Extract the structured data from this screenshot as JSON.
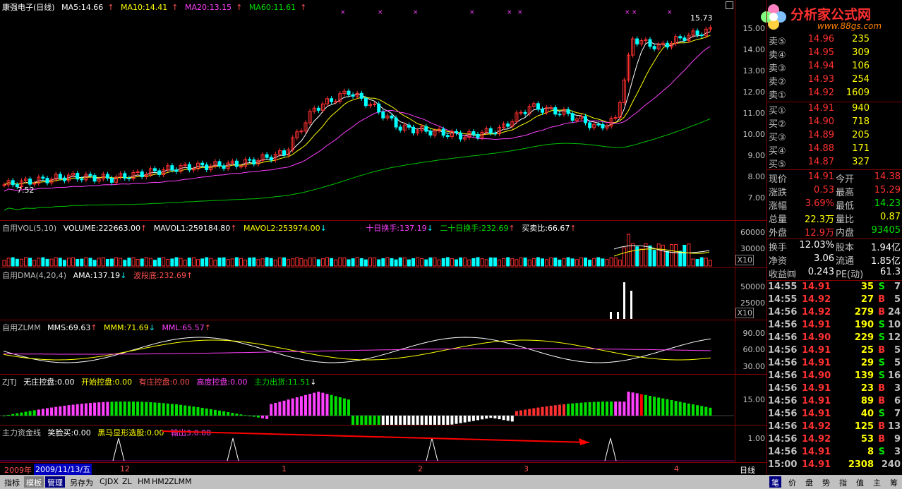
{
  "main": {
    "title": "康强电子(日线)",
    "ma5": "MA5:14.66",
    "ma10": "MA10:14.41",
    "ma20": "MA20:13.15",
    "ma60": "MA60:11.61",
    "high_label": "15.73",
    "low_label": "7.52",
    "yticks": [
      "15.00",
      "14.00",
      "13.00",
      "12.00",
      "11.00",
      "10.00",
      "9.00",
      "8.00",
      "7.00"
    ]
  },
  "vol": {
    "name": "自用VOL(5,10)",
    "volume": "VOLUME:222663.00",
    "mavol1": "MAVOL1:259184.80",
    "mavol2": "MAVOL2:253974.00",
    "turn10": "十日换手:137.19",
    "turn20": "二十日换手:232.69",
    "ratio": "买卖比:66.67",
    "yticks": [
      "60000",
      "30000"
    ],
    "unit": "X10"
  },
  "dma": {
    "name": "自用DMA(4,20,4)",
    "ama": "AMA:137.19",
    "wave": "波段底:232.69",
    "yticks": [
      "50000",
      "25000"
    ],
    "unit": "X10"
  },
  "zlmm": {
    "name": "自用ZLMM",
    "mms": "MMS:69.63",
    "mmm": "MMM:71.69",
    "mml": "MML:65.57",
    "yticks": [
      "90.00",
      "60.00",
      "30.00"
    ]
  },
  "zjtj": {
    "name": "ZJTJ",
    "a": "无庄控盘:0.00",
    "b": "开始控盘:0.00",
    "c": "有庄控盘:0.00",
    "d": "高度控盘:0.00",
    "e": "主力出货:11.51",
    "ytick": "15.00"
  },
  "zljx": {
    "name": "主力资金线",
    "a": "笑脸买:0.00",
    "b": "黑马显形选股:0.00",
    "c": "输出3:0.00",
    "ytick": "1.00"
  },
  "xaxis": {
    "year": "2009年",
    "date": "2009/11/13/五",
    "m12": "12",
    "m1": "1",
    "m2": "2",
    "m3": "3",
    "m4": "4",
    "period": "日线"
  },
  "logo": {
    "name": "分析家公式网",
    "url": "www.88gs.com"
  },
  "quotes": {
    "sell": [
      {
        "l": "卖⑤",
        "p": "14.96",
        "v": "235"
      },
      {
        "l": "卖④",
        "p": "14.95",
        "v": "309"
      },
      {
        "l": "卖③",
        "p": "14.94",
        "v": "106"
      },
      {
        "l": "卖②",
        "p": "14.93",
        "v": "254"
      },
      {
        "l": "卖①",
        "p": "14.92",
        "v": "1609"
      }
    ],
    "buy": [
      {
        "l": "买①",
        "p": "14.91",
        "v": "940"
      },
      {
        "l": "买②",
        "p": "14.90",
        "v": "718"
      },
      {
        "l": "买③",
        "p": "14.89",
        "v": "205"
      },
      {
        "l": "买④",
        "p": "14.88",
        "v": "171"
      },
      {
        "l": "买⑤",
        "p": "14.87",
        "v": "327"
      }
    ],
    "stats": [
      {
        "a": "现价",
        "av": "14.91",
        "b": "今开",
        "bv": "14.38"
      },
      {
        "a": "涨跌",
        "av": "0.53",
        "b": "最高",
        "bv": "15.29"
      },
      {
        "a": "涨幅",
        "av": "3.69%",
        "b": "最低",
        "bv": "14.23"
      },
      {
        "a": "总量",
        "av": "22.3万",
        "b": "量比",
        "bv": "0.87"
      },
      {
        "a": "外盘",
        "av": "12.9万",
        "b": "内盘",
        "bv": "93405"
      },
      {
        "a": "换手",
        "av": "12.03%",
        "b": "股本",
        "bv": "1.94亿"
      },
      {
        "a": "净资",
        "av": "3.06",
        "b": "流通",
        "bv": "1.85亿"
      },
      {
        "a": "收益㈣",
        "av": "0.243",
        "b": "PE(动)",
        "bv": "61.3"
      }
    ]
  },
  "ticks": [
    {
      "t": "14:55",
      "p": "14.91",
      "v": "35",
      "s": "S",
      "n": "7"
    },
    {
      "t": "14:55",
      "p": "14.92",
      "v": "27",
      "s": "B",
      "n": "5"
    },
    {
      "t": "14:56",
      "p": "14.92",
      "v": "279",
      "s": "B",
      "n": "24"
    },
    {
      "t": "14:56",
      "p": "14.91",
      "v": "190",
      "s": "S",
      "n": "10"
    },
    {
      "t": "14:56",
      "p": "14.90",
      "v": "229",
      "s": "S",
      "n": "12"
    },
    {
      "t": "14:56",
      "p": "14.91",
      "v": "25",
      "s": "B",
      "n": "5"
    },
    {
      "t": "14:56",
      "p": "14.91",
      "v": "29",
      "s": "S",
      "n": "5"
    },
    {
      "t": "14:56",
      "p": "14.90",
      "v": "139",
      "s": "S",
      "n": "16"
    },
    {
      "t": "14:56",
      "p": "14.91",
      "v": "23",
      "s": "B",
      "n": "3"
    },
    {
      "t": "14:56",
      "p": "14.91",
      "v": "89",
      "s": "B",
      "n": "6"
    },
    {
      "t": "14:56",
      "p": "14.91",
      "v": "40",
      "s": "S",
      "n": "7"
    },
    {
      "t": "14:56",
      "p": "14.92",
      "v": "125",
      "s": "B",
      "n": "13"
    },
    {
      "t": "14:56",
      "p": "14.92",
      "v": "53",
      "s": "B",
      "n": "9"
    },
    {
      "t": "14:56",
      "p": "14.91",
      "v": "8",
      "s": "S",
      "n": "3"
    },
    {
      "t": "15:00",
      "p": "14.91",
      "v": "2308",
      "s": "",
      "n": "240"
    }
  ],
  "bottom": {
    "left": [
      "指标",
      "模板",
      "管理",
      "另存为",
      "CJDX",
      "ZL",
      "HM",
      "HM2",
      "ZLMM"
    ],
    "right": [
      "笔",
      "价",
      "盘",
      "势",
      "指",
      "值",
      "主",
      "筹"
    ]
  }
}
